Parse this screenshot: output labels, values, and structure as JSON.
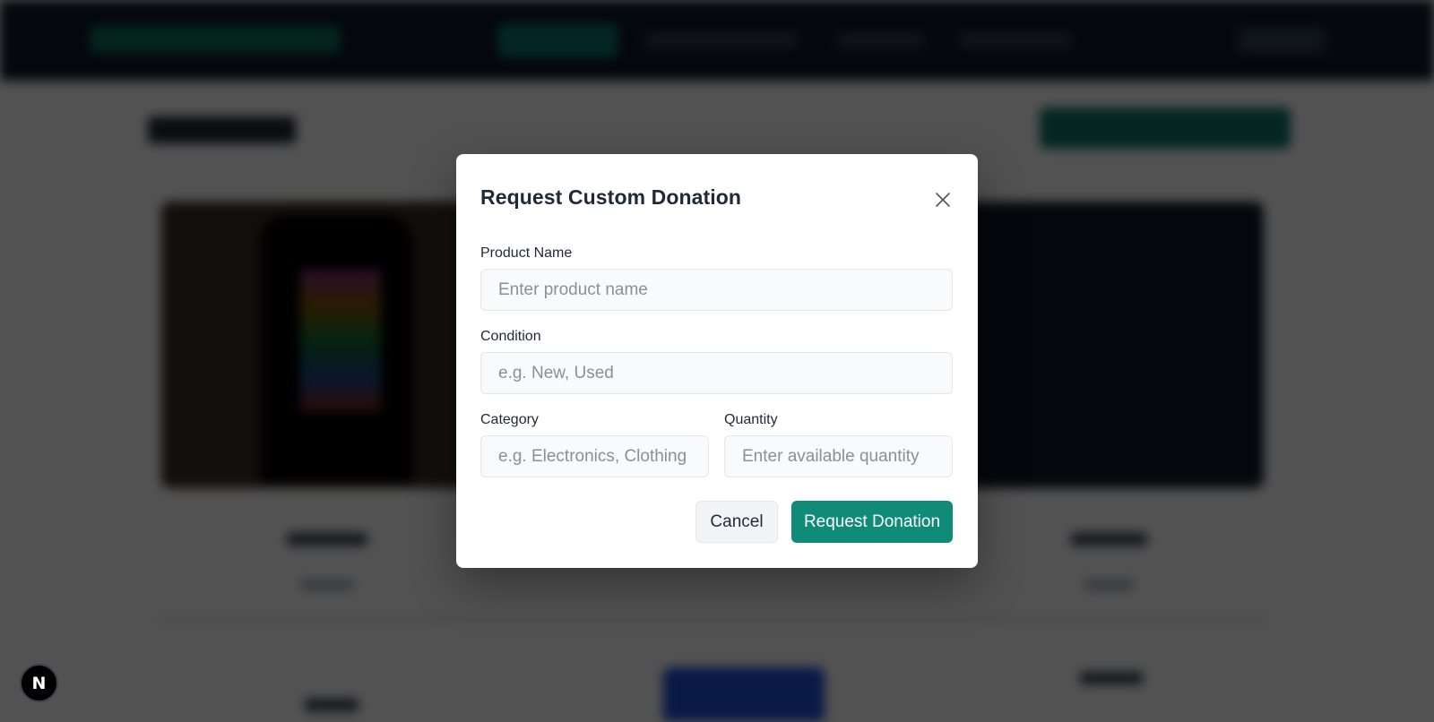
{
  "modal": {
    "title": "Request Custom Donation",
    "close_icon": "close-icon",
    "fields": {
      "product_name": {
        "label": "Product Name",
        "placeholder": "Enter product name",
        "value": ""
      },
      "condition": {
        "label": "Condition",
        "placeholder": "e.g. New, Used",
        "value": ""
      },
      "category": {
        "label": "Category",
        "placeholder": "e.g. Electronics, Clothing",
        "value": ""
      },
      "quantity": {
        "label": "Quantity",
        "placeholder": "Enter available quantity",
        "value": ""
      }
    },
    "buttons": {
      "cancel_label": "Cancel",
      "submit_label": "Request Donation"
    }
  },
  "dev_indicator": {
    "letter": "N",
    "icon": "nextjs-logo-icon"
  },
  "colors": {
    "accent": "#0f8b78",
    "overlay": "rgba(0,0,0,0.68)",
    "nav_background": "#0f172a"
  }
}
